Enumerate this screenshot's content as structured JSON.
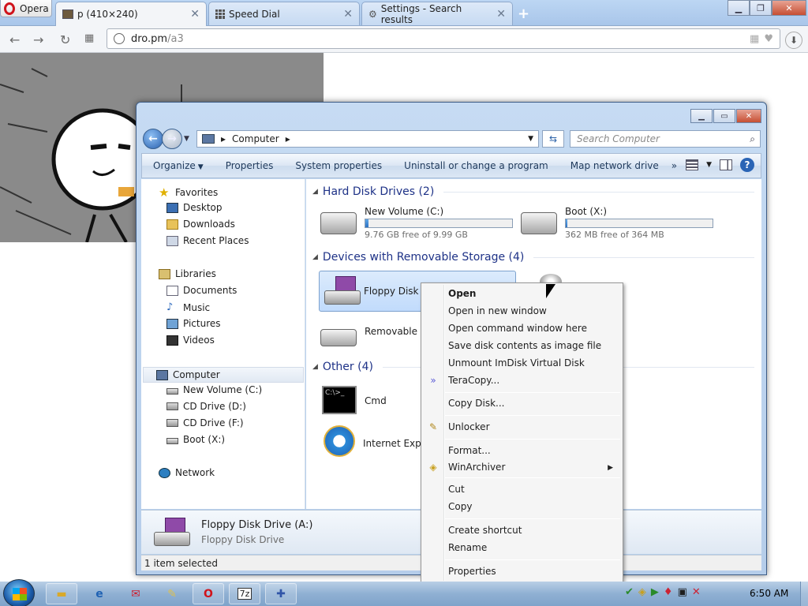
{
  "browser": {
    "menu_label": "Opera",
    "tabs": [
      {
        "label": "p (410×240)",
        "icon": "image-thumbnail-icon",
        "active": true
      },
      {
        "label": "Speed Dial",
        "icon": "speed-dial-icon",
        "active": false
      },
      {
        "label": "Settings - Search results",
        "icon": "gear-icon",
        "active": false
      }
    ],
    "url_host": "dro.pm",
    "url_path": "/a3"
  },
  "explorer": {
    "breadcrumb": [
      "Computer"
    ],
    "search_placeholder": "Search Computer",
    "commands": [
      "Organize",
      "Properties",
      "System properties",
      "Uninstall or change a program",
      "Map network drive"
    ],
    "more": "»",
    "nav": {
      "favorites": "Favorites",
      "favorites_items": [
        "Desktop",
        "Downloads",
        "Recent Places"
      ],
      "libraries": "Libraries",
      "libraries_items": [
        "Documents",
        "Music",
        "Pictures",
        "Videos"
      ],
      "computer": "Computer",
      "computer_items": [
        "New Volume (C:)",
        "CD Drive (D:)",
        "CD Drive (F:)",
        "Boot (X:)"
      ],
      "network": "Network"
    },
    "groups": {
      "hdd": "Hard Disk Drives (2)",
      "removable": "Devices with Removable Storage (4)",
      "other": "Other (4)"
    },
    "drives": [
      {
        "name": "New Volume (C:)",
        "free": "9.76 GB free of 9.99 GB",
        "used_fraction": 0.02
      },
      {
        "name": "Boot (X:)",
        "free": "362 MB free of 364 MB",
        "used_fraction": 0.01
      }
    ],
    "removable_items": [
      "Floppy Disk Dr",
      "Removable Di"
    ],
    "other_items": [
      "Cmd",
      "Internet Explo"
    ],
    "details": {
      "name": "Floppy Disk Drive (A:)",
      "type": "Floppy Disk Drive"
    },
    "status": "1 item selected"
  },
  "context_menu": {
    "open": "Open",
    "open_new_window": "Open in new window",
    "open_cmd": "Open command window here",
    "save_image": "Save disk contents as image file",
    "unmount": "Unmount ImDisk Virtual Disk",
    "teracopy": "TeraCopy...",
    "copy_disk": "Copy Disk...",
    "unlocker": "Unlocker",
    "format": "Format...",
    "winarchiver": "WinArchiver",
    "cut": "Cut",
    "copy": "Copy",
    "create_shortcut": "Create shortcut",
    "rename": "Rename",
    "properties": "Properties"
  },
  "taskbar": {
    "clock": "6:50 AM"
  }
}
